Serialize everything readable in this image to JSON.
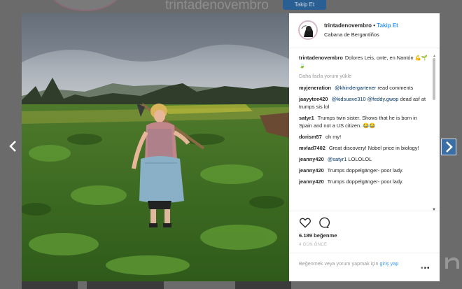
{
  "background": {
    "username": "trintadenovembro",
    "follow_label": "Takip Et"
  },
  "post": {
    "username": "trintadenovembro",
    "separator": "•",
    "follow_label": "Takip Et",
    "location": "Cabana de Bergantiños",
    "caption": {
      "user": "trintadenovembro",
      "text": "Dolores Leis, onte, en Nantón",
      "emoji": "💪🌱🍃"
    },
    "load_more_label": "Daha fazla yorum yükle",
    "comments": [
      {
        "user": "myjeneration",
        "mention": "@khindergartener",
        "text": "read comments"
      },
      {
        "user": "jaayytee420",
        "mention": "@kidsuave310 @feddy.gwop",
        "text": "dead asf at trumps sis lol"
      },
      {
        "user": "satyr1",
        "mention": "",
        "text": "Trumps twin sister. Shows that he is born in Spain and not a US citizen. 😂😂"
      },
      {
        "user": "dorism57",
        "mention": "",
        "text": "oh my!"
      },
      {
        "user": "mvlad7402",
        "mention": "",
        "text": "Great discovery! Nobel price in biology!"
      },
      {
        "user": "jeanny420",
        "mention": "@satyr1",
        "text": "LOLOLOL"
      },
      {
        "user": "jeanny420",
        "mention": "",
        "text": "Trumps doppelgänger- poor lady."
      },
      {
        "user": "jeanny420",
        "mention": "",
        "text": "Trumps doppelgänger- poor lady."
      }
    ],
    "likes_label": "6.189 beğenme",
    "time_ago": "4 GÜN ÖNCE",
    "login_prompt_prefix": "Beğenmek veya yorum yapmak için",
    "login_link": "giriş yap",
    "icons": {
      "heart": "heart-icon",
      "comment": "comment-icon",
      "more": "more-options-icon",
      "left": "chevron-left-icon",
      "right": "chevron-right-icon"
    }
  },
  "colors": {
    "link_blue": "#3897f0",
    "mention_blue": "#003569",
    "text": "#262626",
    "muted": "#999999"
  }
}
